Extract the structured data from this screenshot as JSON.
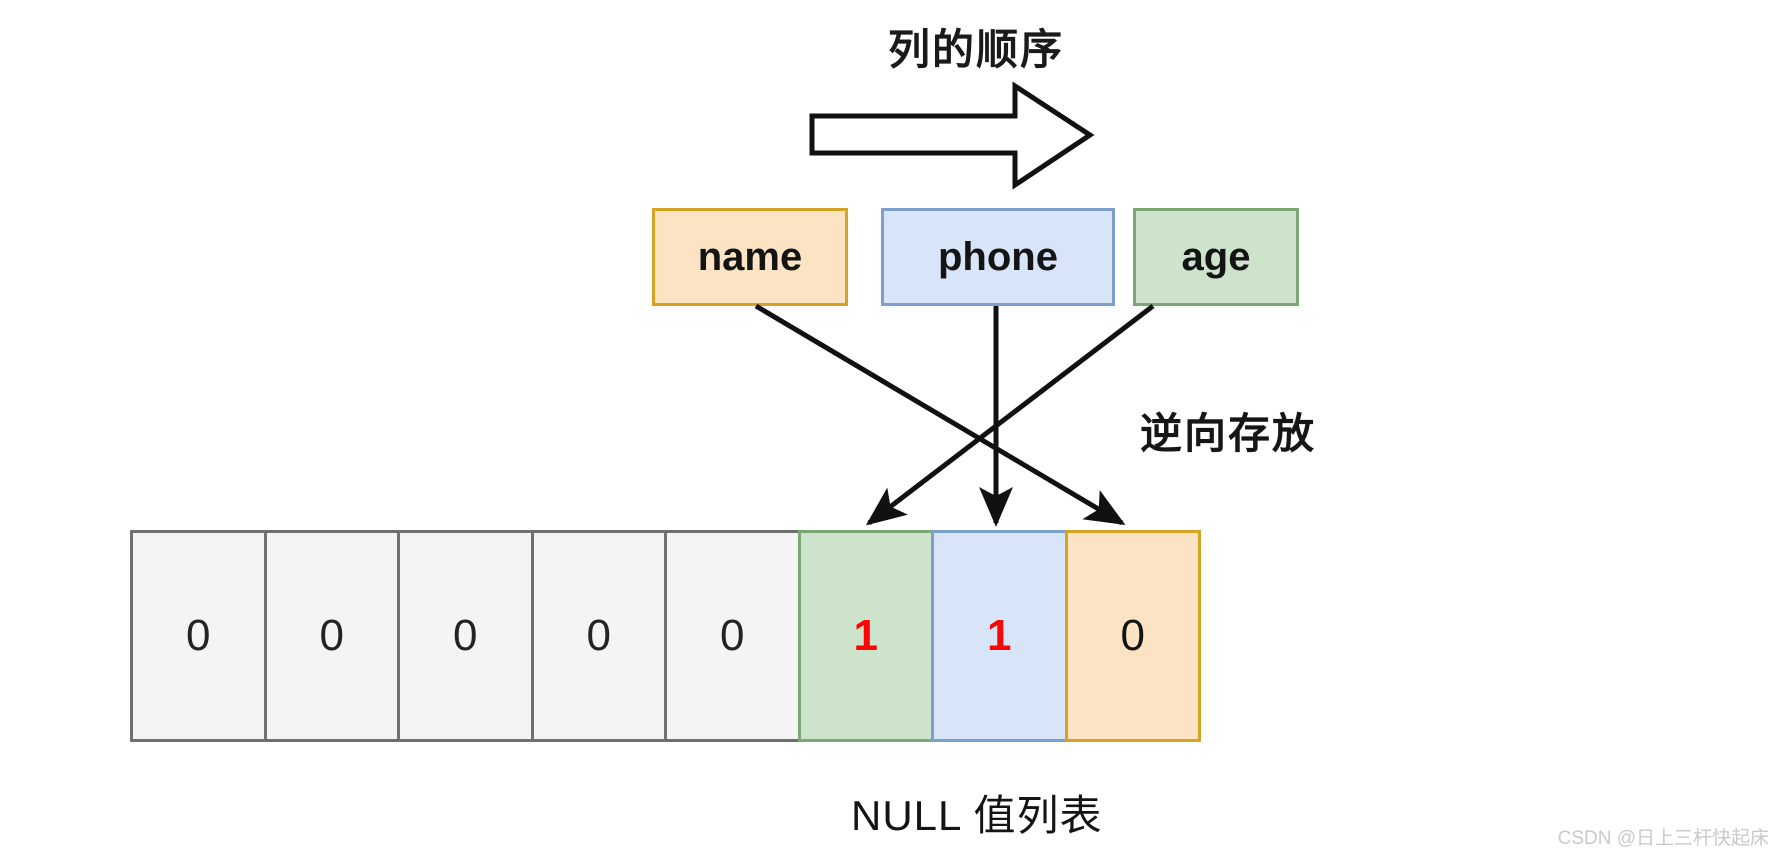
{
  "diagram": {
    "title": "列的顺序",
    "direction_arrow_icon": "right-block-arrow-icon",
    "note_reverse_order": "逆向存放",
    "caption": "NULL 值列表",
    "watermark": "CSDN @日上三杆快起床",
    "columns": [
      {
        "label": "name",
        "fill": "#fce3c4",
        "stroke": "#d6a324"
      },
      {
        "label": "phone",
        "fill": "#d8e5f8",
        "stroke": "#7e9fcc"
      },
      {
        "label": "age",
        "fill": "#cde3cb",
        "stroke": "#7ba775"
      }
    ],
    "null_bitmap": [
      {
        "value": "0",
        "kind": "gray"
      },
      {
        "value": "0",
        "kind": "gray"
      },
      {
        "value": "0",
        "kind": "gray"
      },
      {
        "value": "0",
        "kind": "gray"
      },
      {
        "value": "0",
        "kind": "gray"
      },
      {
        "value": "1",
        "kind": "green"
      },
      {
        "value": "1",
        "kind": "blue"
      },
      {
        "value": "0",
        "kind": "orange"
      }
    ],
    "mappings": [
      {
        "from": "name",
        "to_cell_index": 7,
        "arrow": "diagonal-down-right"
      },
      {
        "from": "phone",
        "to_cell_index": 6,
        "arrow": "straight-down"
      },
      {
        "from": "age",
        "to_cell_index": 5,
        "arrow": "diagonal-down-left"
      }
    ],
    "colors": {
      "orange_fill": "#fce3c4",
      "orange_stroke": "#d6a324",
      "blue_fill": "#d8e5f8",
      "blue_stroke": "#7e9fcc",
      "green_fill": "#cde3cb",
      "green_stroke": "#7ba775",
      "gray_fill": "#f4f4f4",
      "gray_stroke": "#6f6f6f",
      "highlight_text": "#fb0606",
      "watermark_text": "#c9c9c9"
    }
  }
}
